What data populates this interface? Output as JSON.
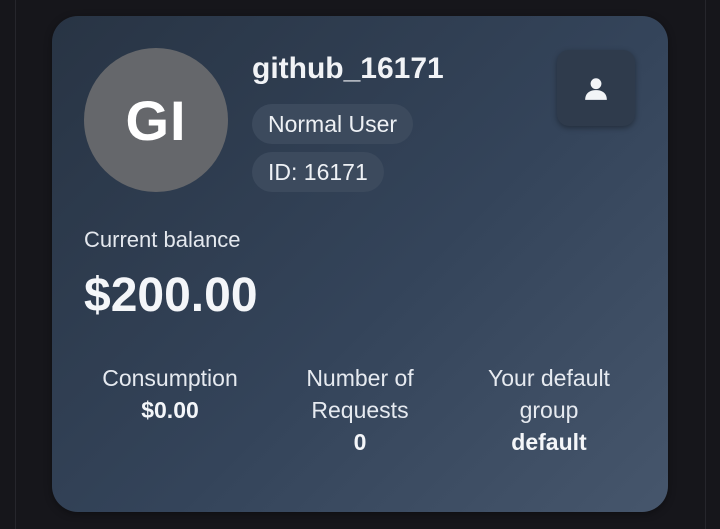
{
  "user": {
    "avatar_initials": "GI",
    "username": "github_16171",
    "role": "Normal User",
    "id_label": "ID: 16171"
  },
  "icons": {
    "profile": "user-silhouette-icon"
  },
  "balance": {
    "label": "Current balance",
    "value": "$200.00"
  },
  "stats": {
    "consumption": {
      "label": "Consumption",
      "value": "$0.00"
    },
    "requests": {
      "label_line1": "Number of",
      "label_line2": "Requests",
      "value": "0"
    },
    "group": {
      "label_line1": "Your default",
      "label_line2": "group",
      "value": "default"
    }
  },
  "colors": {
    "page_background": "#16161b",
    "card_gradient_start": "#283444",
    "card_gradient_end": "#46566c",
    "avatar_background": "#65676b",
    "badge_background": "#3c4a5d"
  }
}
